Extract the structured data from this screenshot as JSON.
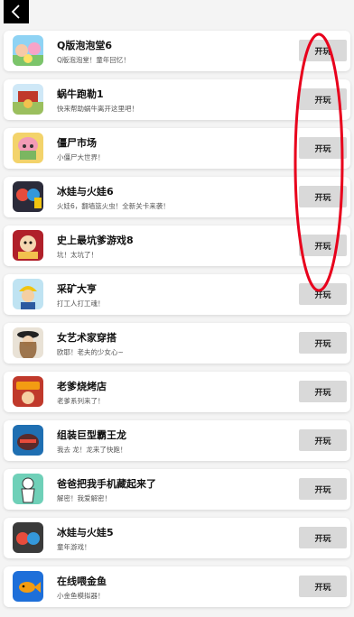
{
  "header": {
    "back_icon": "chevron-left-icon"
  },
  "games": [
    {
      "title": "Q版泡泡堂6",
      "desc": "Q版泡泡堂！童年回忆！",
      "play": "开玩"
    },
    {
      "title": "蜗牛跑勒1",
      "desc": "快来帮助蜗牛离开这里吧！",
      "play": "开玩"
    },
    {
      "title": "僵尸市场",
      "desc": "小僵尸大世界！",
      "play": "开玩"
    },
    {
      "title": "冰娃与火娃6",
      "desc": "火娃6，翻墙篮火虫！全新关卡来袭！",
      "play": "开玩"
    },
    {
      "title": "史上最坑爹游戏8",
      "desc": "坑！太坑了！",
      "play": "开玩"
    },
    {
      "title": "采矿大亨",
      "desc": "打工人打工魂！",
      "play": "开玩"
    },
    {
      "title": "女艺术家穿搭",
      "desc": "欧耶！老夫的少女心~",
      "play": "开玩"
    },
    {
      "title": "老爹烧烤店",
      "desc": "老爹系列来了！",
      "play": "开玩"
    },
    {
      "title": "组装巨型霸王龙",
      "desc": "我去 龙！龙来了快跑！",
      "play": "开玩"
    },
    {
      "title": "爸爸把我手机藏起来了",
      "desc": "解密！我爱解密！",
      "play": "开玩"
    },
    {
      "title": "冰娃与火娃5",
      "desc": "童年游戏！",
      "play": "开玩"
    },
    {
      "title": "在线喂金鱼",
      "desc": "小金鱼模拟器！",
      "play": "开玩"
    }
  ],
  "colors": {
    "annotation": "#e8001c",
    "button_bg": "#d9d9d9"
  }
}
